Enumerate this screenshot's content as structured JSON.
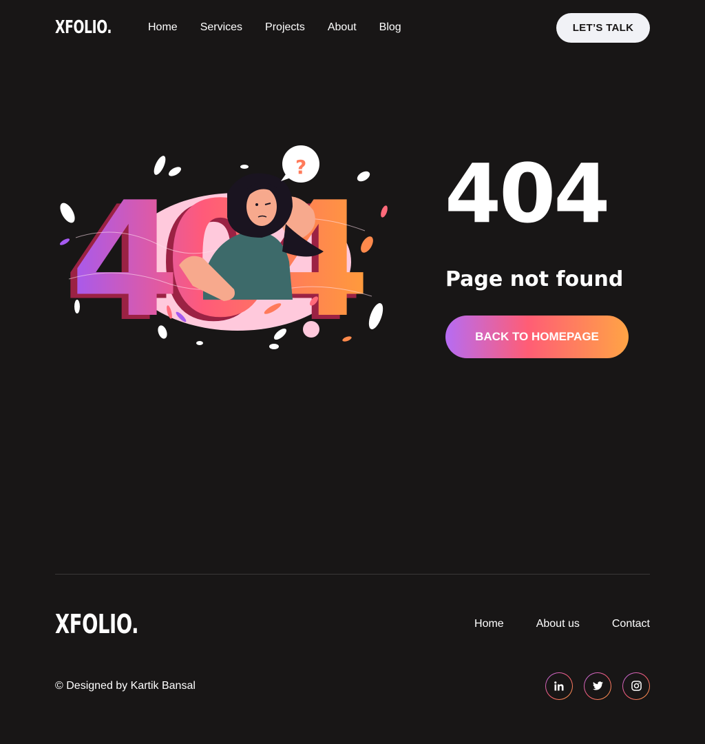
{
  "brand": {
    "logo": "XFOLIO."
  },
  "header": {
    "nav": [
      "Home",
      "Services",
      "Projects",
      "About",
      "Blog"
    ],
    "cta": "LET’S TALK"
  },
  "hero": {
    "illustration_text": "404",
    "illustration_symbol": "?",
    "code": "404",
    "message": "Page not found",
    "button": "BACK TO HOMEPAGE"
  },
  "footer": {
    "nav": [
      "Home",
      "About us",
      "Contact"
    ],
    "copyright": "© Designed by Kartik Bansal",
    "socials": [
      "linkedin-icon",
      "twitter-icon",
      "instagram-icon"
    ]
  },
  "colors": {
    "background": "#181616",
    "text": "#ffffff",
    "gradient_start": "#b66cf3",
    "gradient_mid": "#ff5d75",
    "gradient_end": "#ffa445",
    "cta_bg": "#f1f2f6"
  }
}
